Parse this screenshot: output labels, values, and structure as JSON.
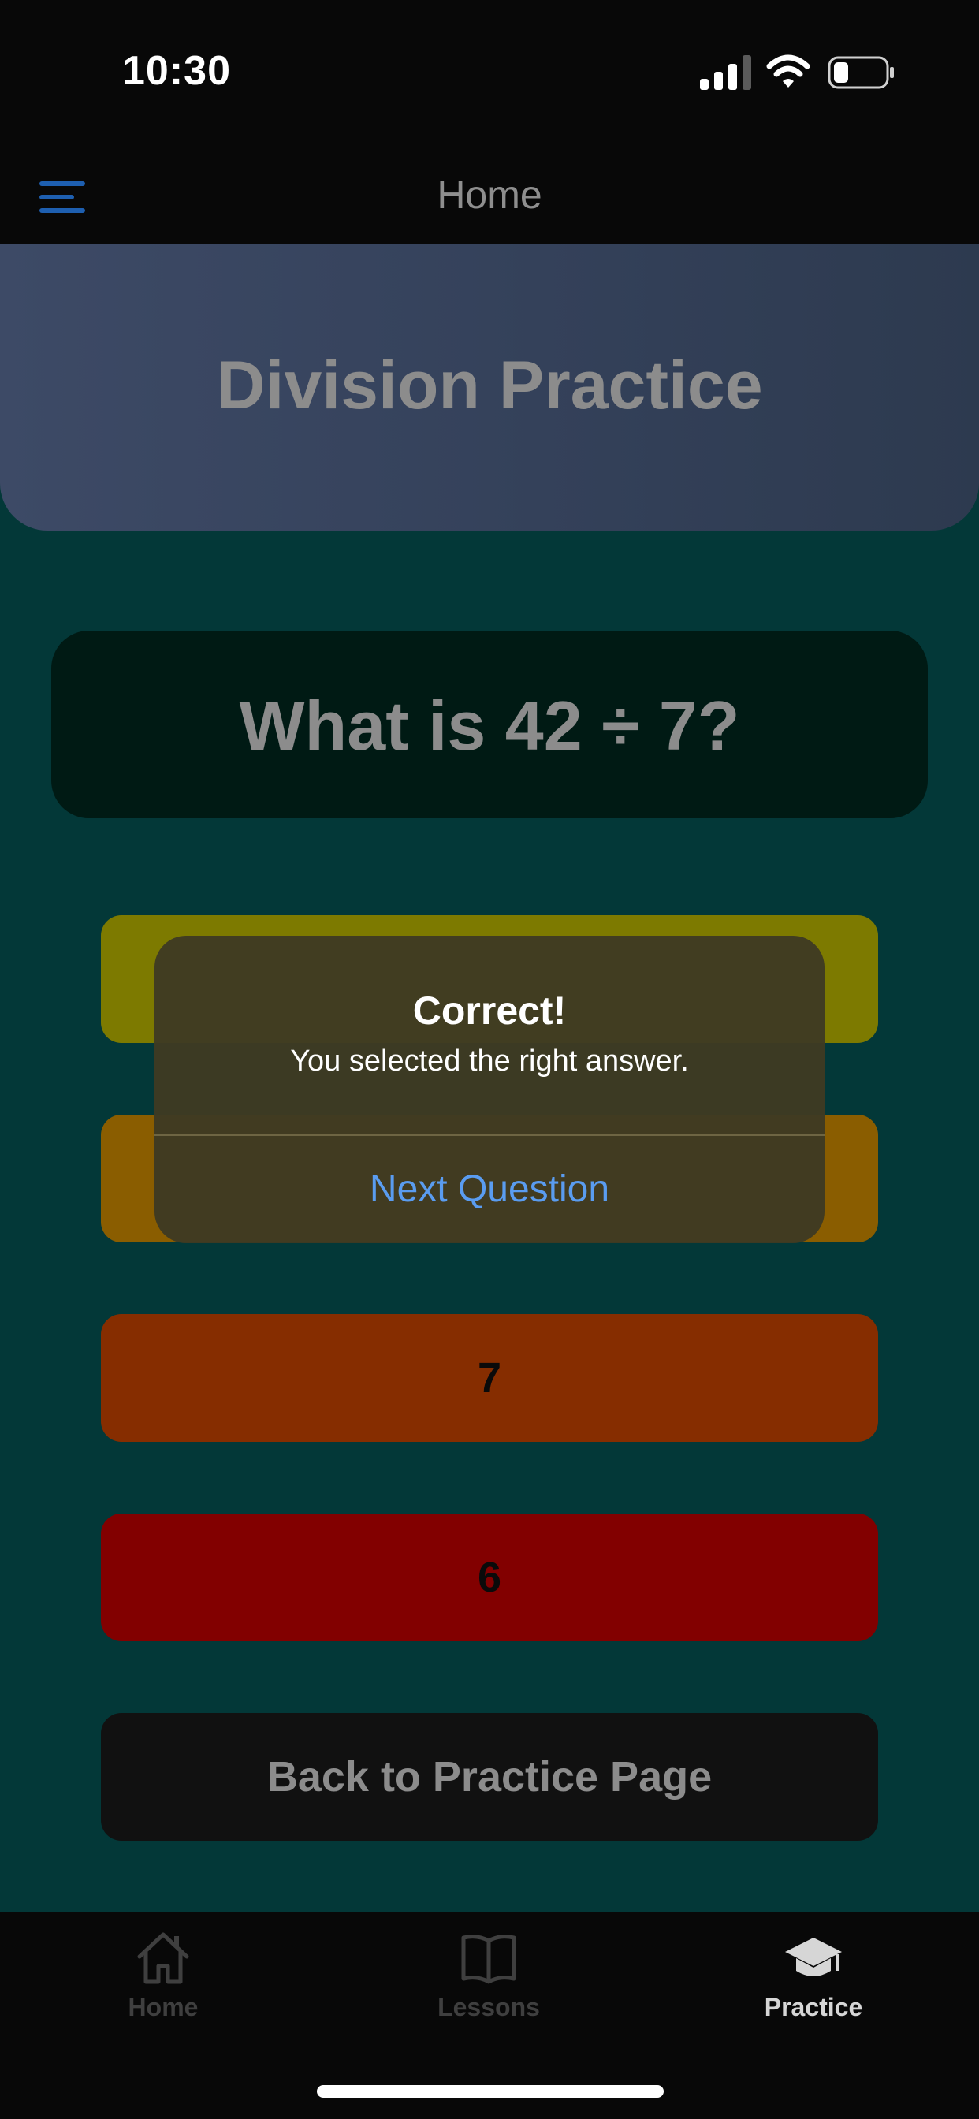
{
  "status_bar": {
    "time": "10:30",
    "icons": [
      "signal-icon",
      "wifi-icon",
      "battery-icon"
    ]
  },
  "nav": {
    "title": "Home",
    "menu_icon": "menu-icon"
  },
  "header": {
    "title": "Division Practice"
  },
  "question": {
    "text": "What is 42 ÷ 7?"
  },
  "answers": [
    {
      "label": "",
      "color": "#7d7a00"
    },
    {
      "label": "",
      "color": "#8a5d00"
    },
    {
      "label": "7",
      "color": "#862d00"
    },
    {
      "label": "6",
      "color": "#820000"
    }
  ],
  "back_button": {
    "label": "Back to Practice Page"
  },
  "alert": {
    "title": "Correct!",
    "message": "You selected the right answer.",
    "action": "Next Question"
  },
  "tab_bar": {
    "items": [
      {
        "label": "Home",
        "icon": "home-icon",
        "selected": false
      },
      {
        "label": "Lessons",
        "icon": "book-icon",
        "selected": false
      },
      {
        "label": "Practice",
        "icon": "graduation-cap-icon",
        "selected": true
      }
    ]
  },
  "colors": {
    "background": "#033838",
    "accent": "#5a9cf0",
    "menu_icon": "#1e5fb0"
  }
}
